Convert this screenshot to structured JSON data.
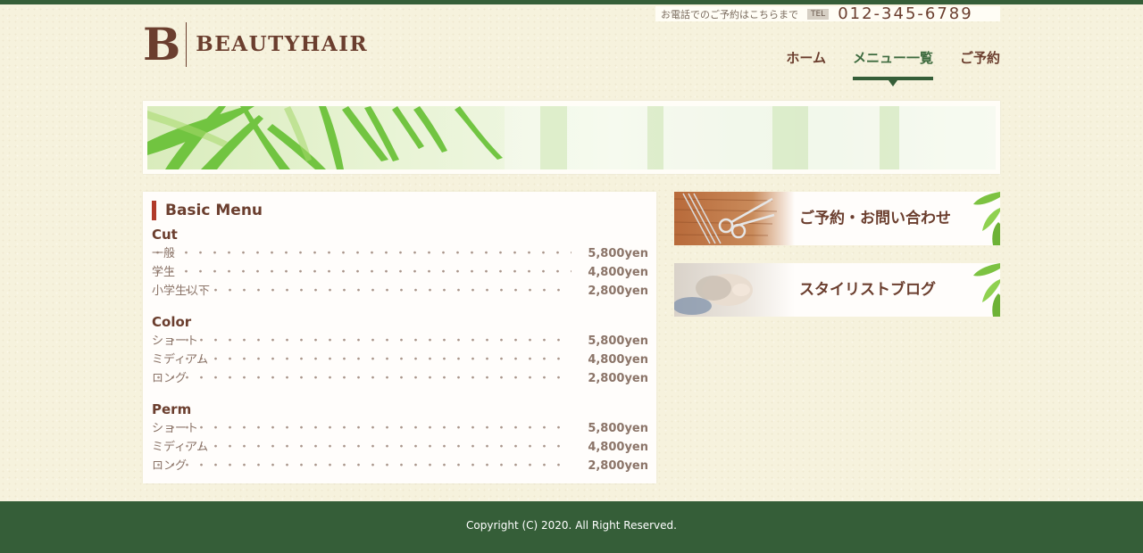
{
  "header": {
    "logo_mark": "B",
    "logo_text": "BEAUTYHAIR",
    "tel_lead": "お電話でのご予約はこちらまで",
    "tel_badge": "TEL",
    "tel_number": "012-345-6789"
  },
  "nav": {
    "items": [
      {
        "label": "ホーム"
      },
      {
        "label": "メニュー一覧",
        "active": true
      },
      {
        "label": "ご予約"
      }
    ]
  },
  "menu": {
    "heading": "Basic Menu",
    "sections": [
      {
        "title": "Cut",
        "rows": [
          {
            "name": "一般",
            "price": "5,800yen"
          },
          {
            "name": "学生",
            "price": "4,800yen"
          },
          {
            "name": "小学生以下",
            "price": "2,800yen"
          }
        ]
      },
      {
        "title": "Color",
        "rows": [
          {
            "name": "ショート",
            "price": "5,800yen"
          },
          {
            "name": "ミディアム",
            "price": "4,800yen"
          },
          {
            "name": "ロング",
            "price": "2,800yen"
          }
        ]
      },
      {
        "title": "Perm",
        "rows": [
          {
            "name": "ショート",
            "price": "5,800yen"
          },
          {
            "name": "ミディアム",
            "price": "4,800yen"
          },
          {
            "name": "ロング",
            "price": "2,800yen"
          }
        ]
      }
    ]
  },
  "sidebar": {
    "reserve_label": "ご予約・お問い合わせ",
    "blog_label": "スタイリストブログ"
  },
  "footer": {
    "copyright": "Copyright (C) 2020. All Right Reserved."
  },
  "colors": {
    "brand_green": "#355e38",
    "brand_brown": "#6b3e2e",
    "accent_red": "#b13a2a"
  }
}
